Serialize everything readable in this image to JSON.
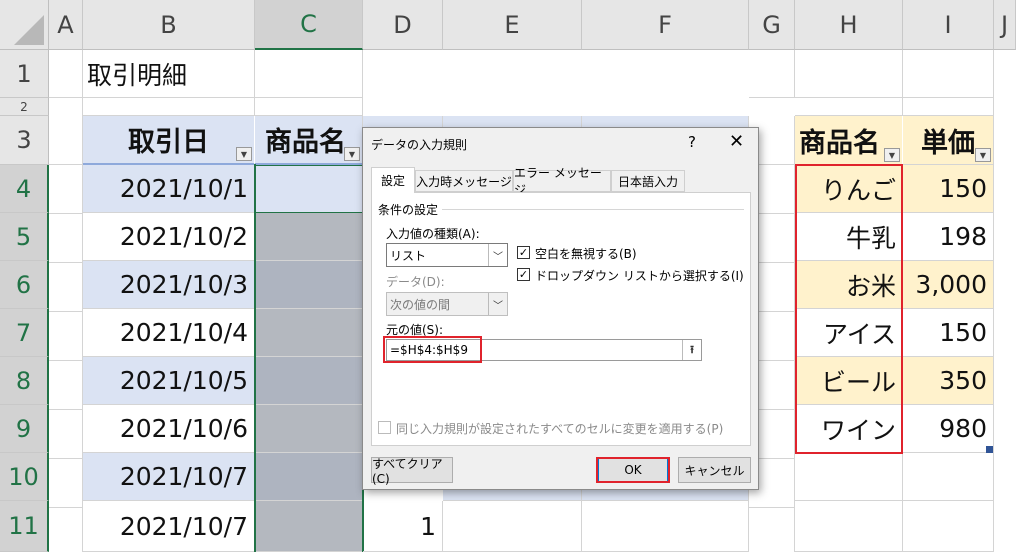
{
  "columns": [
    "A",
    "B",
    "C",
    "D",
    "E",
    "F",
    "G",
    "H",
    "I",
    "J"
  ],
  "rows": [
    "1",
    "2",
    "3",
    "4",
    "5",
    "6",
    "7",
    "8",
    "9",
    "10",
    "11"
  ],
  "title_cell": "取引明細",
  "table_headers": {
    "date": "取引日",
    "product": "商品名"
  },
  "dates": [
    "2021/10/1",
    "2021/10/2",
    "2021/10/3",
    "2021/10/4",
    "2021/10/5",
    "2021/10/6",
    "2021/10/7",
    "2021/10/7"
  ],
  "d11_value": "1",
  "price_table": {
    "header_product": "商品名",
    "header_price": "単価",
    "rows": [
      {
        "product": "りんご",
        "price": "150"
      },
      {
        "product": "牛乳",
        "price": "198"
      },
      {
        "product": "お米",
        "price": "3,000"
      },
      {
        "product": "アイス",
        "price": "150"
      },
      {
        "product": "ビール",
        "price": "350"
      },
      {
        "product": "ワイン",
        "price": "980"
      }
    ]
  },
  "dialog": {
    "title": "データの入力規則",
    "help": "?",
    "close": "✕",
    "tabs": [
      "設定",
      "入力時メッセージ",
      "エラー メッセージ",
      "日本語入力"
    ],
    "section_label": "条件の設定",
    "allow_label": "入力値の種類(A):",
    "allow_value": "リスト",
    "ignore_blank": "空白を無視する(B)",
    "in_cell_dropdown": "ドロップダウン リストから選択する(I)",
    "data_label": "データ(D):",
    "data_value": "次の値の間",
    "source_label": "元の値(S):",
    "source_value": "=$H$4:$H$9",
    "apply_all": "同じ入力規則が設定されたすべてのセルに変更を適用する(P)",
    "clear_all": "すべてクリア(C)",
    "ok": "OK",
    "cancel": "キャンセル"
  },
  "colors": {
    "header_blue": "#dbe3f3",
    "band_yellow": "#fff2cc",
    "selection_gray": "#aeb4c0",
    "highlight_red": "#e0232c"
  }
}
